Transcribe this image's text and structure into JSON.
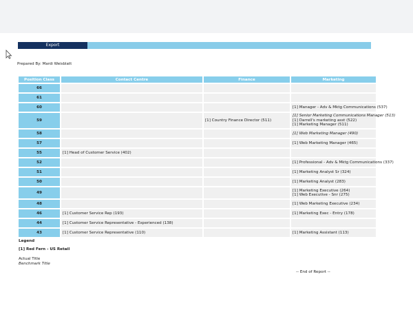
{
  "toolbar": {
    "export_label": "Export"
  },
  "report": {
    "prepared_by": "Prepared By: Mardi Weisblatt",
    "headers": [
      "Position Class",
      "Contact Centre",
      "Finance",
      "Marketing"
    ],
    "rows": [
      {
        "pc": "66",
        "contact": [],
        "finance": [],
        "marketing": [],
        "h": 12
      },
      {
        "pc": "61",
        "contact": [],
        "finance": [],
        "marketing": [],
        "h": 12
      },
      {
        "pc": "60",
        "contact": [],
        "finance": [],
        "marketing": [
          {
            "t": "[1] Manager - Adv & Mktg Communications (537)"
          }
        ],
        "h": 12
      },
      {
        "pc": "59",
        "contact": [],
        "finance": [
          {
            "t": "[1] Country Finance Director (511)"
          }
        ],
        "marketing": [
          {
            "t": "[1] Senior Marketing Communications Manager (513)",
            "i": true
          },
          {
            "t": "[1] Darrell's marketing asst (522)"
          },
          {
            "t": "[1] Marketing Manager (511)"
          }
        ],
        "h": 22
      },
      {
        "pc": "58",
        "contact": [],
        "finance": [],
        "marketing": [
          {
            "t": "[1] Web Marketing Manager (490)",
            "i": true
          }
        ],
        "h": 12
      },
      {
        "pc": "57",
        "contact": [],
        "finance": [],
        "marketing": [
          {
            "t": "[1] Web Marketing Manager (465)"
          }
        ],
        "h": 12
      },
      {
        "pc": "55",
        "contact": [
          {
            "t": "[1] Head of Customer Service (402)"
          }
        ],
        "finance": [],
        "marketing": [],
        "h": 12
      },
      {
        "pc": "52",
        "contact": [],
        "finance": [],
        "marketing": [
          {
            "t": "[1] Professional - Adv & Mktg Communications (337)"
          }
        ],
        "h": 12
      },
      {
        "pc": "51",
        "contact": [],
        "finance": [],
        "marketing": [
          {
            "t": "[1] Marketing Analyst Sr (324)"
          }
        ],
        "h": 12
      },
      {
        "pc": "50",
        "contact": [],
        "finance": [],
        "marketing": [
          {
            "t": "[1] Marketing Analyst (283)"
          }
        ],
        "h": 12
      },
      {
        "pc": "49",
        "contact": [],
        "finance": [],
        "marketing": [
          {
            "t": "[1] Marketing Executive (264)"
          },
          {
            "t": "[1] Web Executive - Snr (275)"
          }
        ],
        "h": 16
      },
      {
        "pc": "48",
        "contact": [],
        "finance": [],
        "marketing": [
          {
            "t": "[1] Web Marketing Executive (234)"
          }
        ],
        "h": 12
      },
      {
        "pc": "46",
        "contact": [
          {
            "t": "[1] Customer Service Rep (193)"
          }
        ],
        "finance": [],
        "marketing": [
          {
            "t": "[1] Marketing Exec - Entry (178)"
          }
        ],
        "h": 12
      },
      {
        "pc": "44",
        "contact": [
          {
            "t": "[1] Customer Service Representative - Experienced (138)"
          }
        ],
        "finance": [],
        "marketing": [],
        "h": 12
      },
      {
        "pc": "43",
        "contact": [
          {
            "t": "[1] Customer Service Representative (110)"
          }
        ],
        "finance": [],
        "marketing": [
          {
            "t": "[1] Marketing Assistant (113)"
          }
        ],
        "h": 12
      }
    ]
  },
  "legend": {
    "title": "Legend",
    "entry": "[1] Red Fern - US Retail",
    "actual": "Actual Title",
    "benchmark": "Benchmark Title"
  },
  "footer": {
    "end": "-- End of Report --"
  }
}
